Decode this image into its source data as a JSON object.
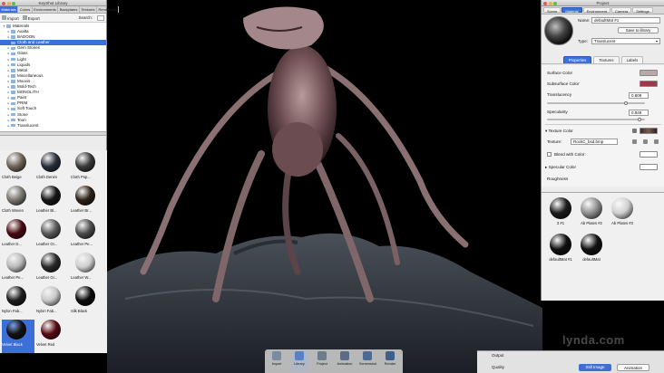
{
  "library": {
    "title": "KeyShot Library",
    "tabs": [
      "Materials",
      "Colors",
      "Environments",
      "Backplates",
      "Textures",
      "Renderings"
    ],
    "active_tab": 0,
    "toolbar": {
      "import_label": "Import",
      "export_label": "Export",
      "search_label": "Search:"
    },
    "tree": [
      {
        "label": "Materials",
        "level": 0,
        "expanded": true
      },
      {
        "label": "Axalta",
        "level": 1
      },
      {
        "label": "BADOON",
        "level": 1
      },
      {
        "label": "Cloth and Leather",
        "level": 1,
        "selected": true
      },
      {
        "label": "Gem Stones",
        "level": 1
      },
      {
        "label": "Glass",
        "level": 1
      },
      {
        "label": "Light",
        "level": 1
      },
      {
        "label": "Liquids",
        "level": 1
      },
      {
        "label": "Metal",
        "level": 1
      },
      {
        "label": "Miscellaneous",
        "level": 1
      },
      {
        "label": "Moovis",
        "level": 1
      },
      {
        "label": "Mold-Tech",
        "level": 1
      },
      {
        "label": "MONOLITH",
        "level": 1
      },
      {
        "label": "Paint",
        "level": 1
      },
      {
        "label": "PRIM",
        "level": 1
      },
      {
        "label": "Soft Touch",
        "level": 1
      },
      {
        "label": "Stone",
        "level": 1
      },
      {
        "label": "Toon",
        "level": 1
      },
      {
        "label": "Translucent",
        "level": 1
      }
    ],
    "swatches": [
      {
        "label": "Cloth Beige",
        "color": "#6e6558"
      },
      {
        "label": "Cloth Denim",
        "color": "#2a2f3a"
      },
      {
        "label": "Cloth Pop...",
        "color": "#3a3a3a"
      },
      {
        "label": "Cloth Woven",
        "color": "#7a776f"
      },
      {
        "label": "Leather Bl...",
        "color": "#161616"
      },
      {
        "label": "Leather Br...",
        "color": "#2e2117"
      },
      {
        "label": "Leather D...",
        "color": "#4a0b14"
      },
      {
        "label": "Leather Gr...",
        "color": "#5a5a5a"
      },
      {
        "label": "Leather Pe...",
        "color": "#4c4c4c"
      },
      {
        "label": "Leather Pe...",
        "color": "#b9b9b9"
      },
      {
        "label": "Leather Gr...",
        "color": "#2a2a2a"
      },
      {
        "label": "Leather W...",
        "color": "#cfcfcf"
      },
      {
        "label": "Nylon Fab...",
        "color": "#1e1e1e"
      },
      {
        "label": "Nylon Fab...",
        "color": "#c8c8c8"
      },
      {
        "label": "Silk Black",
        "color": "#0c0c0c"
      },
      {
        "label": "Velvet Black",
        "color": "#121212",
        "selected": true
      },
      {
        "label": "Velvet Red",
        "color": "#5a0a14"
      }
    ]
  },
  "project": {
    "title": "Project",
    "tabs": [
      "Scene",
      "Material",
      "Environment",
      "Camera",
      "Settings"
    ],
    "active_tab": 1,
    "name_label": "Name:",
    "name_value": "defaultMat #1",
    "save_button": "Save to library",
    "type_label": "Type:",
    "type_value": "Translucent",
    "subtabs": [
      "Properties",
      "Textures",
      "Labels"
    ],
    "active_subtab": 0,
    "properties": {
      "surface_color_label": "Surface Color",
      "surface_color": "#b9a7a9",
      "subsurface_color_label": "Subsurface Color",
      "subsurface_color": "#9a3a47",
      "translucency_label": "Translucency",
      "translucency_value": "0.809",
      "specularity_label": "Specularity",
      "specularity_value": "0.949",
      "texture_color_label": "Texture Color",
      "texture_label": "Texture:",
      "texture_value": "RockC_bsd.bmp",
      "blend_label": "Blend with Color:",
      "specular_color_label": "Specular Color",
      "roughness_label": "Roughness"
    },
    "materials": [
      {
        "label": "3 #1",
        "color": "#1c1c1c"
      },
      {
        "label": "Ab Plates #2",
        "color": "#8f8f8f"
      },
      {
        "label": "Ab Plates #3",
        "color": "#d0d0d0"
      },
      {
        "label": "defaultMat #1",
        "color": "#0f0f0f"
      },
      {
        "label": "defaultMat",
        "color": "#111111"
      }
    ]
  },
  "dock": {
    "items": [
      "Import",
      "Library",
      "Project",
      "Animation",
      "Screenshot",
      "Render"
    ],
    "active": 1
  },
  "output": {
    "output_label": "Output",
    "quality_label": "Quality",
    "still_button": "Still Image",
    "animation_button": "Animation"
  },
  "watermark": "lynda.com"
}
